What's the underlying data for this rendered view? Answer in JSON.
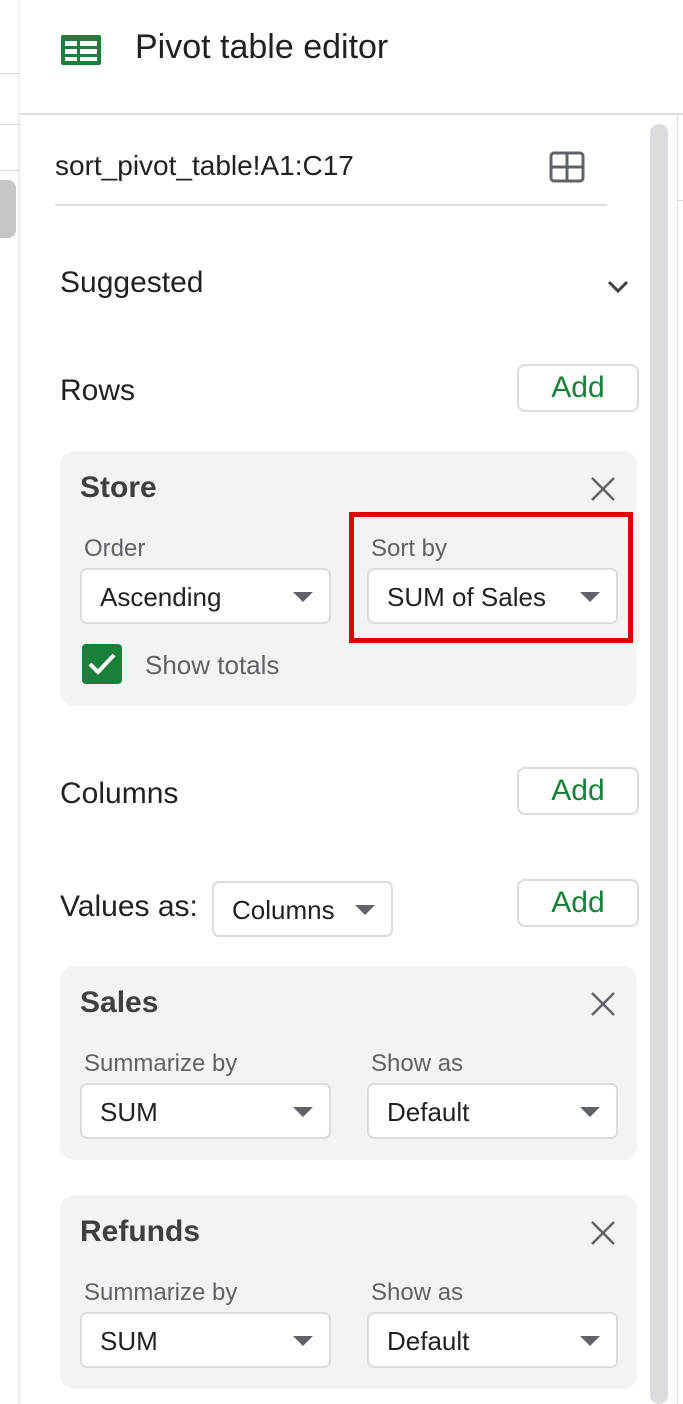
{
  "header": {
    "title": "Pivot table editor"
  },
  "range": {
    "value": "sort_pivot_table!A1:C17"
  },
  "suggested": {
    "label": "Suggested"
  },
  "rows": {
    "label": "Rows",
    "add_label": "Add",
    "card": {
      "title": "Store",
      "order_label": "Order",
      "order_value": "Ascending",
      "sortby_label": "Sort by",
      "sortby_value": "SUM of Sales",
      "show_totals_label": "Show totals",
      "show_totals_checked": true
    }
  },
  "columns": {
    "label": "Columns",
    "add_label": "Add"
  },
  "values": {
    "label": "Values as:",
    "values_as_value": "Columns",
    "add_label": "Add",
    "cards": [
      {
        "title": "Sales",
        "summarize_label": "Summarize by",
        "summarize_value": "SUM",
        "showas_label": "Show as",
        "showas_value": "Default"
      },
      {
        "title": "Refunds",
        "summarize_label": "Summarize by",
        "summarize_value": "SUM",
        "showas_label": "Show as",
        "showas_value": "Default"
      }
    ]
  },
  "colors": {
    "accent_green": "#188038",
    "highlight_red": "#e00000",
    "card_bg": "#f1f3f4"
  }
}
